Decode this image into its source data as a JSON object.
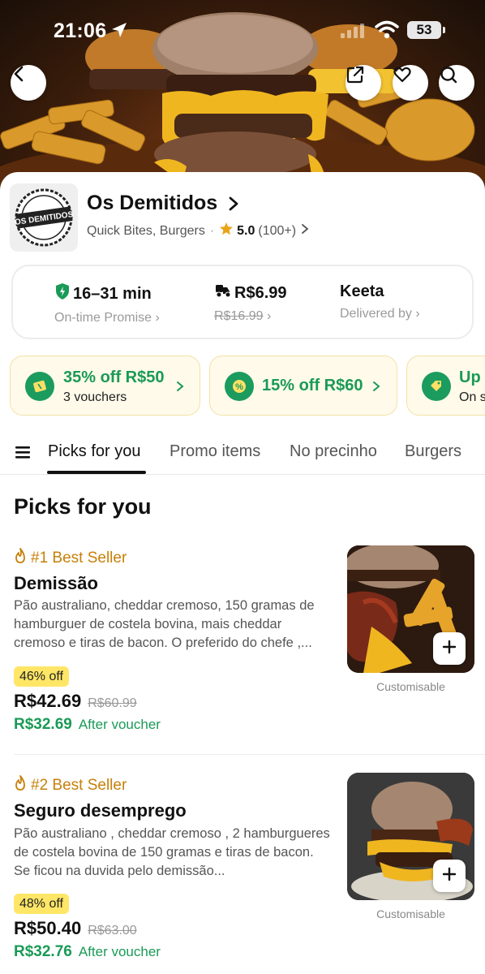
{
  "status_bar": {
    "time": "21:06",
    "battery": "53"
  },
  "store": {
    "name": "Os Demitidos",
    "logo_text": "OS DEMITIDOS",
    "category": "Quick Bites, Burgers",
    "rating": "5.0",
    "rating_count": "(100+)"
  },
  "delivery": {
    "time": "16–31 min",
    "time_label": "On-time Promise",
    "fee": "R$6.99",
    "fee_old": "R$16.99",
    "provider": "Keeta",
    "provider_label": "Delivered by"
  },
  "vouchers": [
    {
      "title": "35% off R$50",
      "subtitle": "3 vouchers",
      "icon": "ticket-icon"
    },
    {
      "title": "15% off R$60",
      "subtitle": "",
      "icon": "percent-icon"
    },
    {
      "title": "Up",
      "subtitle": "On s",
      "icon": "tag-icon"
    }
  ],
  "tabs": [
    "Picks for you",
    "Promo items",
    "No precinho",
    "Burgers"
  ],
  "active_tab": "Picks for you",
  "section_title": "Picks for you",
  "items": [
    {
      "badge": "#1 Best Seller",
      "name": "Demissão",
      "description": "Pão australiano, cheddar cremoso, 150 gramas de hamburguer de costela bovina, mais cheddar cremoso e tiras de bacon. O preferido do chefe ,...",
      "discount": "46% off",
      "price": "R$42.69",
      "price_old": "R$60.99",
      "after_price": "R$32.69",
      "after_label": "After voucher",
      "customisable": "Customisable"
    },
    {
      "badge": "#2 Best Seller",
      "name": "Seguro desemprego",
      "description": "Pão australiano , cheddar cremoso , 2 hamburgueres de costela bovina de 150 gramas e tiras de bacon. Se ficou na duvida pelo demissão...",
      "discount": "48% off",
      "price": "R$50.40",
      "price_old": "R$63.00",
      "after_price": "R$32.76",
      "after_label": "After voucher",
      "customisable": "Customisable"
    }
  ],
  "colors": {
    "accent_green": "#1a9a57",
    "best_seller": "#c7800a",
    "discount_bg": "#ffe666",
    "voucher_bg": "#fffaea"
  }
}
